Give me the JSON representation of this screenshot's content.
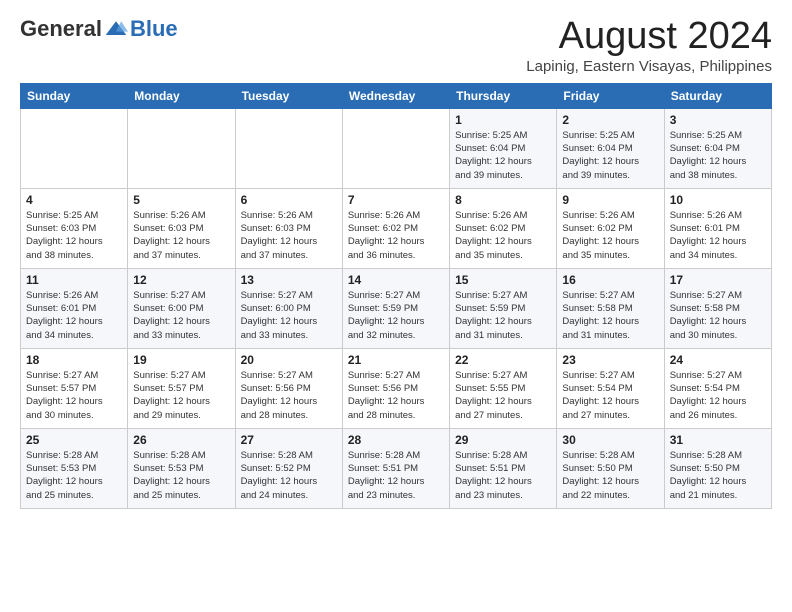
{
  "header": {
    "logo_general": "General",
    "logo_blue": "Blue",
    "month_title": "August 2024",
    "location": "Lapinig, Eastern Visayas, Philippines"
  },
  "days_of_week": [
    "Sunday",
    "Monday",
    "Tuesday",
    "Wednesday",
    "Thursday",
    "Friday",
    "Saturday"
  ],
  "weeks": [
    [
      {
        "day": "",
        "info": ""
      },
      {
        "day": "",
        "info": ""
      },
      {
        "day": "",
        "info": ""
      },
      {
        "day": "",
        "info": ""
      },
      {
        "day": "1",
        "info": "Sunrise: 5:25 AM\nSunset: 6:04 PM\nDaylight: 12 hours\nand 39 minutes."
      },
      {
        "day": "2",
        "info": "Sunrise: 5:25 AM\nSunset: 6:04 PM\nDaylight: 12 hours\nand 39 minutes."
      },
      {
        "day": "3",
        "info": "Sunrise: 5:25 AM\nSunset: 6:04 PM\nDaylight: 12 hours\nand 38 minutes."
      }
    ],
    [
      {
        "day": "4",
        "info": "Sunrise: 5:25 AM\nSunset: 6:03 PM\nDaylight: 12 hours\nand 38 minutes."
      },
      {
        "day": "5",
        "info": "Sunrise: 5:26 AM\nSunset: 6:03 PM\nDaylight: 12 hours\nand 37 minutes."
      },
      {
        "day": "6",
        "info": "Sunrise: 5:26 AM\nSunset: 6:03 PM\nDaylight: 12 hours\nand 37 minutes."
      },
      {
        "day": "7",
        "info": "Sunrise: 5:26 AM\nSunset: 6:02 PM\nDaylight: 12 hours\nand 36 minutes."
      },
      {
        "day": "8",
        "info": "Sunrise: 5:26 AM\nSunset: 6:02 PM\nDaylight: 12 hours\nand 35 minutes."
      },
      {
        "day": "9",
        "info": "Sunrise: 5:26 AM\nSunset: 6:02 PM\nDaylight: 12 hours\nand 35 minutes."
      },
      {
        "day": "10",
        "info": "Sunrise: 5:26 AM\nSunset: 6:01 PM\nDaylight: 12 hours\nand 34 minutes."
      }
    ],
    [
      {
        "day": "11",
        "info": "Sunrise: 5:26 AM\nSunset: 6:01 PM\nDaylight: 12 hours\nand 34 minutes."
      },
      {
        "day": "12",
        "info": "Sunrise: 5:27 AM\nSunset: 6:00 PM\nDaylight: 12 hours\nand 33 minutes."
      },
      {
        "day": "13",
        "info": "Sunrise: 5:27 AM\nSunset: 6:00 PM\nDaylight: 12 hours\nand 33 minutes."
      },
      {
        "day": "14",
        "info": "Sunrise: 5:27 AM\nSunset: 5:59 PM\nDaylight: 12 hours\nand 32 minutes."
      },
      {
        "day": "15",
        "info": "Sunrise: 5:27 AM\nSunset: 5:59 PM\nDaylight: 12 hours\nand 31 minutes."
      },
      {
        "day": "16",
        "info": "Sunrise: 5:27 AM\nSunset: 5:58 PM\nDaylight: 12 hours\nand 31 minutes."
      },
      {
        "day": "17",
        "info": "Sunrise: 5:27 AM\nSunset: 5:58 PM\nDaylight: 12 hours\nand 30 minutes."
      }
    ],
    [
      {
        "day": "18",
        "info": "Sunrise: 5:27 AM\nSunset: 5:57 PM\nDaylight: 12 hours\nand 30 minutes."
      },
      {
        "day": "19",
        "info": "Sunrise: 5:27 AM\nSunset: 5:57 PM\nDaylight: 12 hours\nand 29 minutes."
      },
      {
        "day": "20",
        "info": "Sunrise: 5:27 AM\nSunset: 5:56 PM\nDaylight: 12 hours\nand 28 minutes."
      },
      {
        "day": "21",
        "info": "Sunrise: 5:27 AM\nSunset: 5:56 PM\nDaylight: 12 hours\nand 28 minutes."
      },
      {
        "day": "22",
        "info": "Sunrise: 5:27 AM\nSunset: 5:55 PM\nDaylight: 12 hours\nand 27 minutes."
      },
      {
        "day": "23",
        "info": "Sunrise: 5:27 AM\nSunset: 5:54 PM\nDaylight: 12 hours\nand 27 minutes."
      },
      {
        "day": "24",
        "info": "Sunrise: 5:27 AM\nSunset: 5:54 PM\nDaylight: 12 hours\nand 26 minutes."
      }
    ],
    [
      {
        "day": "25",
        "info": "Sunrise: 5:28 AM\nSunset: 5:53 PM\nDaylight: 12 hours\nand 25 minutes."
      },
      {
        "day": "26",
        "info": "Sunrise: 5:28 AM\nSunset: 5:53 PM\nDaylight: 12 hours\nand 25 minutes."
      },
      {
        "day": "27",
        "info": "Sunrise: 5:28 AM\nSunset: 5:52 PM\nDaylight: 12 hours\nand 24 minutes."
      },
      {
        "day": "28",
        "info": "Sunrise: 5:28 AM\nSunset: 5:51 PM\nDaylight: 12 hours\nand 23 minutes."
      },
      {
        "day": "29",
        "info": "Sunrise: 5:28 AM\nSunset: 5:51 PM\nDaylight: 12 hours\nand 23 minutes."
      },
      {
        "day": "30",
        "info": "Sunrise: 5:28 AM\nSunset: 5:50 PM\nDaylight: 12 hours\nand 22 minutes."
      },
      {
        "day": "31",
        "info": "Sunrise: 5:28 AM\nSunset: 5:50 PM\nDaylight: 12 hours\nand 21 minutes."
      }
    ]
  ]
}
